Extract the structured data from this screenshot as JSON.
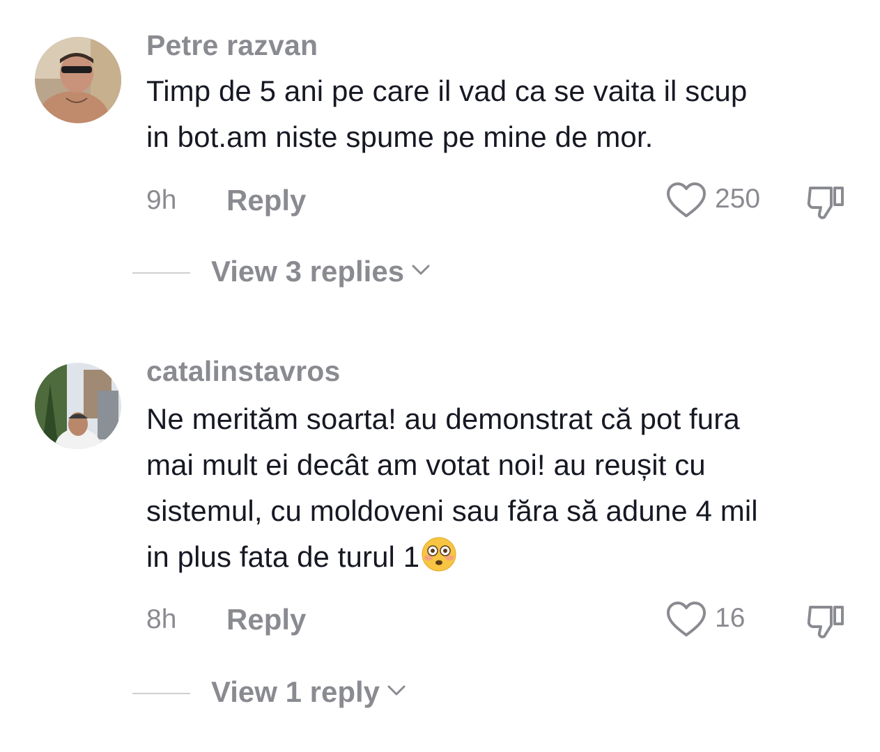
{
  "comments": [
    {
      "username": "Petre razvan",
      "text_lines": [
        "Timp de 5 ani pe care il vad ca se vaita il scup",
        "in bot.am niste spume pe mine de mor."
      ],
      "time": "9h",
      "reply_label": "Reply",
      "likes": "250",
      "view_replies": "View 3 replies",
      "avatar_icon": "profile-photo-man-sunglasses"
    },
    {
      "username": "catalinstavros",
      "text_lines": [
        "Ne merităm soarta! au demonstrat că pot fura",
        "mai mult ei decât am votat noi! au reușit cu",
        "sistemul, cu moldoveni sau făra să adune 4 mil",
        "in plus fata de turul 1"
      ],
      "emoji": "flushed-face-emoji",
      "time": "8h",
      "reply_label": "Reply",
      "likes": "16",
      "view_replies": "View 1 reply",
      "avatar_icon": "profile-photo-man-outdoors"
    }
  ],
  "icons": {
    "like": "heart-outline-icon",
    "dislike": "thumbs-down-outline-icon",
    "expand": "chevron-down-icon"
  },
  "colors": {
    "text": "#161823",
    "muted": "#8a8b91",
    "divider": "#cfcfd3",
    "background": "#ffffff"
  }
}
